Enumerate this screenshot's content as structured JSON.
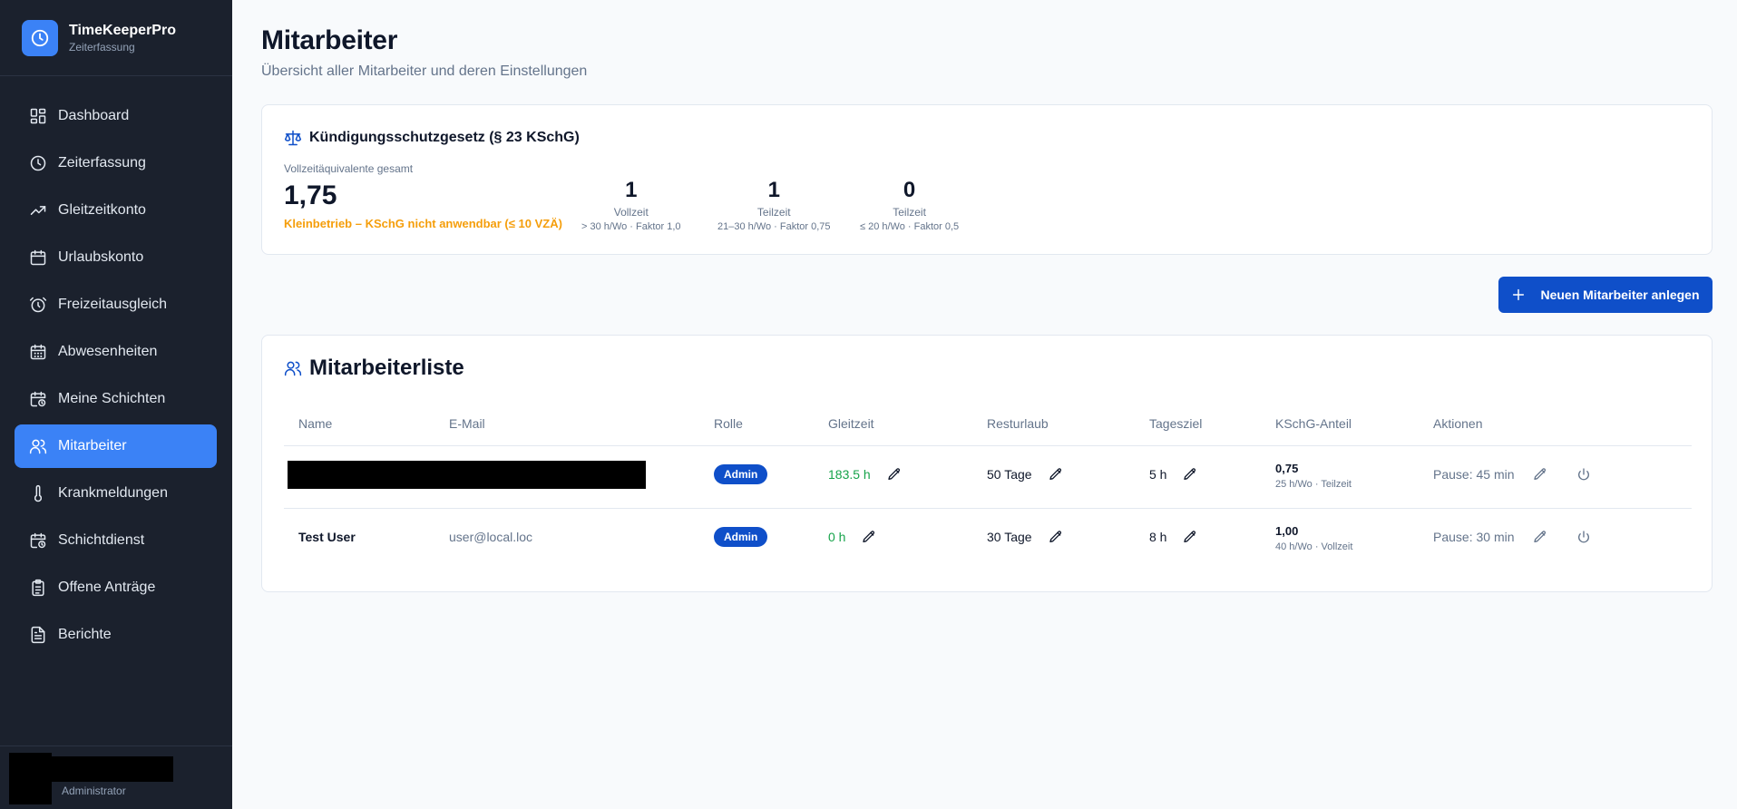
{
  "brand": {
    "title": "TimeKeeperPro",
    "subtitle": "Zeiterfassung"
  },
  "nav": [
    {
      "label": "Dashboard",
      "icon": "dashboard-icon"
    },
    {
      "label": "Zeiterfassung",
      "icon": "clock-icon"
    },
    {
      "label": "Gleitzeitkonto",
      "icon": "trending-up-icon"
    },
    {
      "label": "Urlaubskonto",
      "icon": "calendar-icon"
    },
    {
      "label": "Freizeitausgleich",
      "icon": "alarm-clock-icon"
    },
    {
      "label": "Abwesenheiten",
      "icon": "calendar-days-icon"
    },
    {
      "label": "Meine Schichten",
      "icon": "calendar-clock-icon"
    },
    {
      "label": "Mitarbeiter",
      "icon": "users-icon",
      "active": true
    },
    {
      "label": "Krankmeldungen",
      "icon": "thermometer-icon"
    },
    {
      "label": "Schichtdienst",
      "icon": "calendar-clock-icon"
    },
    {
      "label": "Offene Anträge",
      "icon": "clipboard-list-icon"
    },
    {
      "label": "Berichte",
      "icon": "file-text-icon"
    }
  ],
  "user": {
    "role": "Administrator"
  },
  "page": {
    "title": "Mitarbeiter",
    "subtitle": "Übersicht aller Mitarbeiter und deren Einstellungen"
  },
  "kschg": {
    "heading": "Kündigungsschutzgesetz (§ 23 KSchG)",
    "vza_label": "Vollzeitäquivalente gesamt",
    "vza_value": "1,75",
    "note": "Kleinbetrieb – KSchG nicht anwendbar (≤ 10 VZÄ)",
    "stats": [
      {
        "num": "1",
        "label": "Vollzeit",
        "sub": "> 30 h/Wo · Faktor 1,0"
      },
      {
        "num": "1",
        "label": "Teilzeit",
        "sub": "21–30 h/Wo · Faktor 0,75"
      },
      {
        "num": "0",
        "label": "Teilzeit",
        "sub": "≤ 20 h/Wo · Faktor 0,5"
      }
    ]
  },
  "new_button": "Neuen Mitarbeiter anlegen",
  "list": {
    "heading": "Mitarbeiterliste",
    "columns": [
      "Name",
      "E-Mail",
      "Rolle",
      "Gleitzeit",
      "Resturlaub",
      "Tagesziel",
      "KSchG-Anteil",
      "Aktionen"
    ],
    "rows": [
      {
        "name": "",
        "email": "",
        "role": "Admin",
        "gleitzeit": "183.5 h",
        "resturlaub": "50 Tage",
        "tagesziel": "5 h",
        "kschg": "0,75",
        "kschg_sub": "25 h/Wo · Teilzeit",
        "pause": "Pause: 45 min"
      },
      {
        "name": "Test User",
        "email": "user@local.loc",
        "role": "Admin",
        "gleitzeit": "0 h",
        "resturlaub": "30 Tage",
        "tagesziel": "8 h",
        "kschg": "1,00",
        "kschg_sub": "40 h/Wo · Vollzeit",
        "pause": "Pause: 30 min"
      }
    ]
  },
  "colors": {
    "sidebar_bg": "#1b212d",
    "accent": "#3b82f6",
    "primary_button": "#0f4fc9",
    "warning": "#f59e0b",
    "positive": "#16a34a"
  }
}
